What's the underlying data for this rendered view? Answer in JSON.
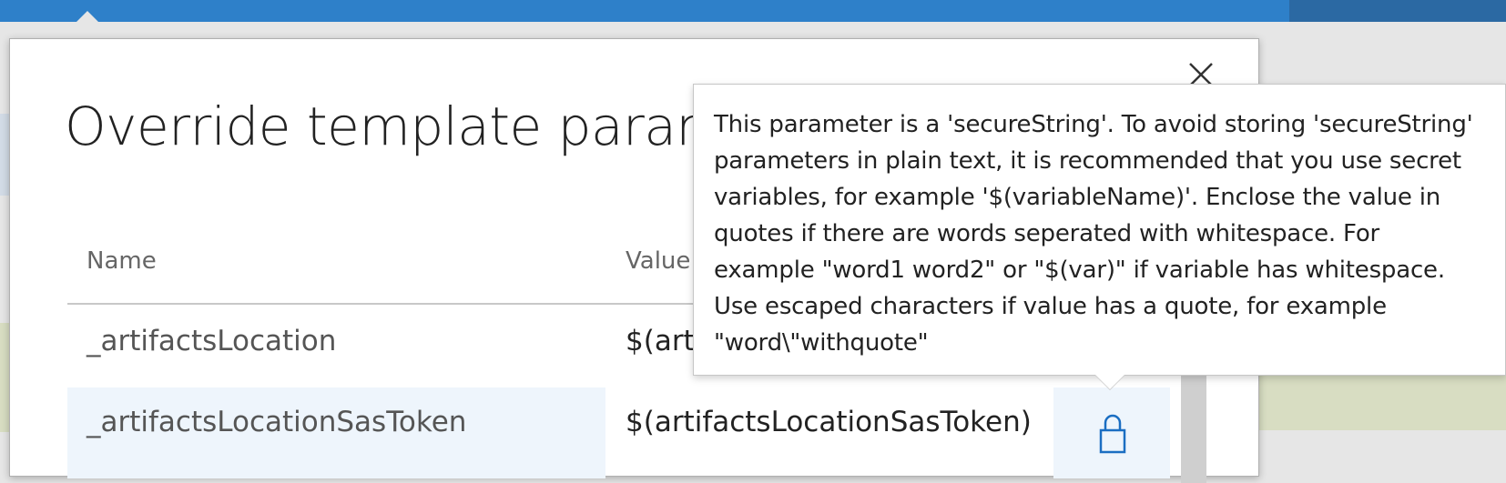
{
  "dialog": {
    "title": "Override template parameters",
    "close_icon": "close-icon"
  },
  "table": {
    "headers": {
      "name": "Name",
      "value": "Value"
    },
    "rows": [
      {
        "name": "_artifactsLocation",
        "value": "$(artifactsLocation)"
      },
      {
        "name": "_artifactsLocationSasToken",
        "value": "$(artifactsLocationSasToken)",
        "icon": "lock-icon"
      }
    ]
  },
  "tooltip": {
    "lines": [
      "This parameter is a 'secureString'. To avoid storing 'secureString'",
      "parameters in plain text, it is recommended that you use secret",
      "variables, for example '$(variableName)'. Enclose the value in",
      "quotes if there are words seperated with whitespace. For",
      "example \"word1 word2\" or \"$(var)\" if variable has whitespace.",
      "Use escaped characters if value has a quote, for example",
      "\"word\\\"withquote\""
    ]
  },
  "colors": {
    "accent": "#2e80c9",
    "selected_row": "#eef5fc",
    "lock_icon": "#1b6ec2"
  }
}
